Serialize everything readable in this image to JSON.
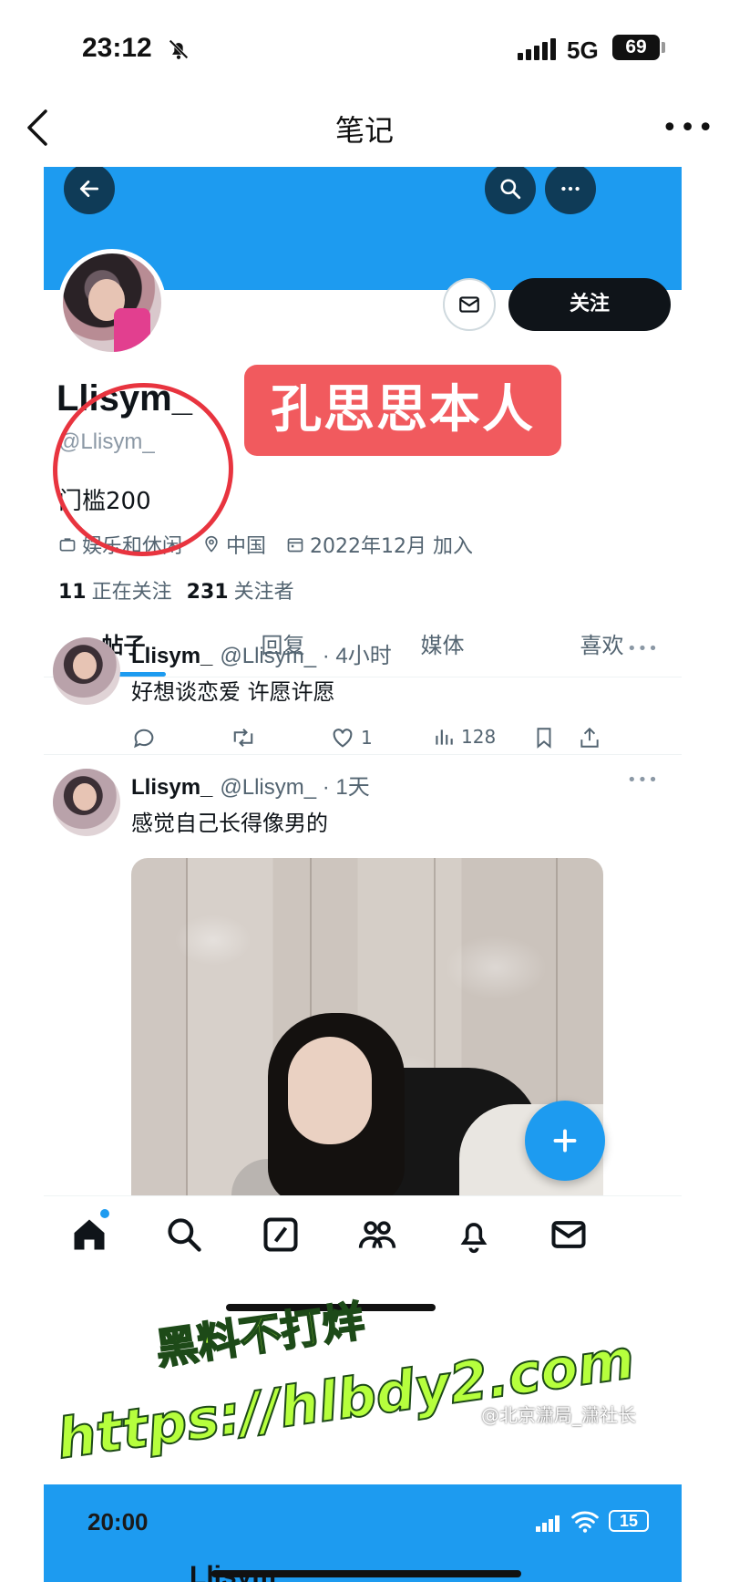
{
  "status_bar": {
    "time": "23:12",
    "network": "5G",
    "battery": "69"
  },
  "nav": {
    "title": "笔记",
    "more": "•••"
  },
  "profile": {
    "follow_button": "关注",
    "display_name": "Llisym_",
    "handle": "@Llisym_",
    "bio": "门槛200",
    "category": "娱乐和休闲",
    "location": "中国",
    "joined": "2022年12月 加入",
    "following_count": "11",
    "following_label": "正在关注",
    "followers_count": "231",
    "followers_label": "关注者"
  },
  "tabs": [
    {
      "label": "帖子"
    },
    {
      "label": "回复"
    },
    {
      "label": "媒体"
    },
    {
      "label": "喜欢"
    }
  ],
  "tweets": [
    {
      "name": "Llisym_",
      "meta": "@Llisym_ · 4小时",
      "text": "好想谈恋爱 许愿许愿",
      "likes": "1",
      "views": "128"
    },
    {
      "name": "Llisym_",
      "meta": "@Llisym_ · 1天",
      "text": "感觉自己长得像男的"
    }
  ],
  "annotation": {
    "label": "孔思思本人"
  },
  "lower_screen": {
    "time": "20:00",
    "battery": "15",
    "name": "Llisym_"
  },
  "watermark": {
    "line1": "黑料不打烊",
    "line2": "https://hlbdy2.com"
  },
  "credit": "@北京潇局_潇社长",
  "colors": {
    "accent": "#1d9bf0",
    "annotation_red": "#f15a5e",
    "watermark_green": "#b6ff3d"
  },
  "icons": [
    "back-icon",
    "search-icon",
    "more-icon",
    "mail-icon",
    "home-icon",
    "compose-icon",
    "communities-icon",
    "bell-icon",
    "reply-icon",
    "retweet-icon",
    "heart-icon",
    "views-icon",
    "bookmark-icon",
    "share-icon",
    "plus-icon"
  ]
}
